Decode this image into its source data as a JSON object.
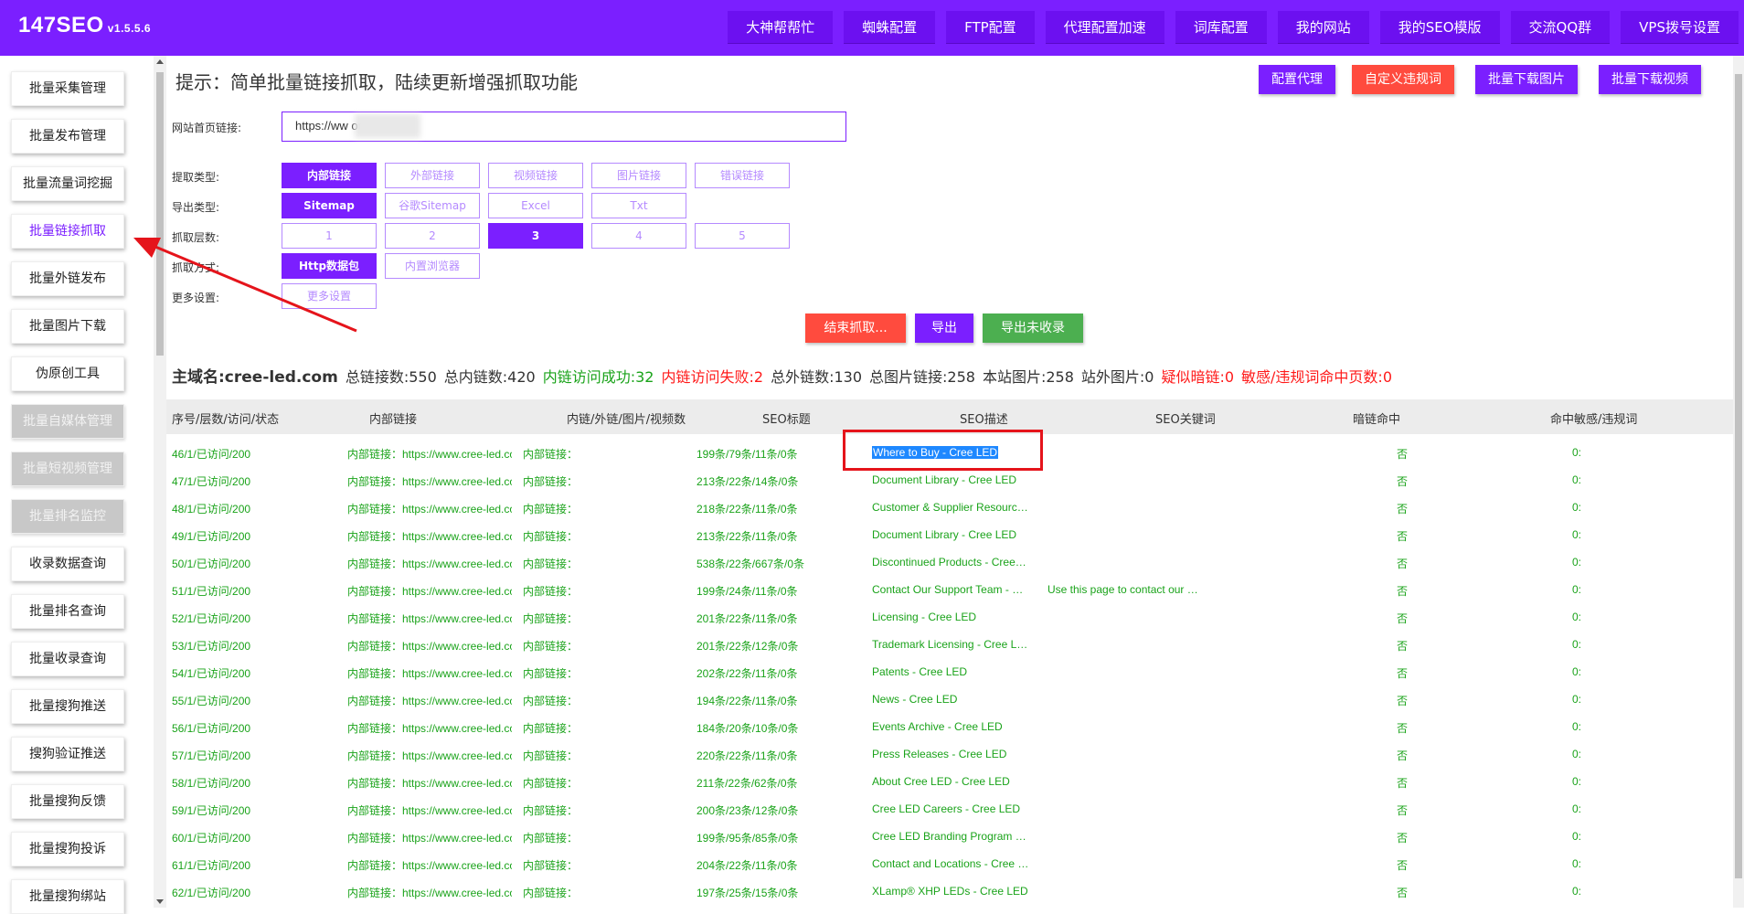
{
  "header": {
    "brand": "147SEO",
    "version": "v1.5.5.6",
    "nav": [
      "大神帮帮忙",
      "蜘蛛配置",
      "FTP配置",
      "代理配置加速",
      "词库配置",
      "我的网站",
      "我的SEO模版",
      "交流QQ群",
      "VPS拨号设置"
    ]
  },
  "sidebar": {
    "items": [
      {
        "label": "批量采集管理",
        "state": "normal"
      },
      {
        "label": "批量发布管理",
        "state": "normal"
      },
      {
        "label": "批量流量词挖掘",
        "state": "normal"
      },
      {
        "label": "批量链接抓取",
        "state": "active"
      },
      {
        "label": "批量外链发布",
        "state": "normal"
      },
      {
        "label": "批量图片下载",
        "state": "normal"
      },
      {
        "label": "伪原创工具",
        "state": "normal"
      },
      {
        "label": "批量自媒体管理",
        "state": "disabled"
      },
      {
        "label": "批量短视频管理",
        "state": "disabled"
      },
      {
        "label": "批量排名监控",
        "state": "disabled"
      },
      {
        "label": "收录数据查询",
        "state": "normal"
      },
      {
        "label": "批量排名查询",
        "state": "normal"
      },
      {
        "label": "批量收录查询",
        "state": "normal"
      },
      {
        "label": "批量搜狗推送",
        "state": "normal"
      },
      {
        "label": "搜狗验证推送",
        "state": "normal"
      },
      {
        "label": "批量搜狗反馈",
        "state": "normal"
      },
      {
        "label": "批量搜狗投诉",
        "state": "normal"
      },
      {
        "label": "批量搜狗绑站",
        "state": "normal"
      }
    ]
  },
  "main": {
    "hint": "提示：简单批量链接抓取，陆续更新增强抓取功能",
    "actions": [
      "配置代理",
      "自定义违规词",
      "批量下载图片",
      "批量下载视频"
    ],
    "url_label": "网站首页链接:",
    "url_value": "https://ww                    om/",
    "fields": {
      "extract_type": {
        "label": "提取类型:",
        "options": [
          "内部链接",
          "外部链接",
          "视频链接",
          "图片链接",
          "错误链接"
        ],
        "selected": "内部链接"
      },
      "export_type": {
        "label": "导出类型:",
        "options": [
          "Sitemap",
          "谷歌Sitemap",
          "Excel",
          "Txt"
        ],
        "selected": "Sitemap"
      },
      "depth": {
        "label": "抓取层数:",
        "options": [
          "1",
          "2",
          "3",
          "4",
          "5"
        ],
        "selected": "3"
      },
      "mode": {
        "label": "抓取方式:",
        "options": [
          "Http数据包",
          "内置浏览器"
        ],
        "selected": "Http数据包"
      },
      "more": {
        "label": "更多设置:",
        "options": [
          "更多设置"
        ]
      }
    },
    "controls": {
      "stop": "结束抓取...",
      "export": "导出",
      "export_unindexed": "导出未收录"
    },
    "stats": {
      "domain": "主域名:cree-led.com",
      "total_links": "总链接数:550",
      "internal_links": "总内链数:420",
      "internal_ok": "内链访问成功:32",
      "internal_fail": "内链访问失败:2",
      "external_links": "总外链数:130",
      "image_links": "总图片链接:258",
      "site_images": "本站图片:258",
      "external_images": "站外图片:0",
      "suspect_hidden": "疑似暗链:0",
      "sensitive_pages": "敏感/违规词命中页数:0"
    },
    "table": {
      "columns": [
        "序号/层数/访问/状态",
        "内部链接",
        "内链/外链/图片/视频数",
        "SEO标题",
        "SEO描述",
        "SEO关键词",
        "暗链命中",
        "命中敏感/违规词"
      ],
      "rows": [
        {
          "seq": "46/1/已访问/200",
          "link": "内部链接：https://www.cree-led.com/",
          "type": "内部链接：",
          "counts": "199条/79条/11条/0条",
          "title": "Where to Buy - Cree LED",
          "desc": "",
          "hidden": "否",
          "hit": "0:"
        },
        {
          "seq": "47/1/已访问/200",
          "link": "内部链接：https://www.cree-led.com/",
          "type": "内部链接：",
          "counts": "213条/22条/14条/0条",
          "title": "Document Library - Cree LED",
          "desc": "",
          "hidden": "否",
          "hit": "0:"
        },
        {
          "seq": "48/1/已访问/200",
          "link": "内部链接：https://www.cree-led.com/",
          "type": "内部链接：",
          "counts": "218条/22条/11条/0条",
          "title": "Customer & Supplier Resources - Cree LED",
          "desc": "",
          "hidden": "否",
          "hit": "0:"
        },
        {
          "seq": "49/1/已访问/200",
          "link": "内部链接：https://www.cree-led.com/",
          "type": "内部链接：",
          "counts": "213条/22条/11条/0条",
          "title": "Document Library - Cree LED",
          "desc": "",
          "hidden": "否",
          "hit": "0:"
        },
        {
          "seq": "50/1/已访问/200",
          "link": "内部链接：https://www.cree-led.com/",
          "type": "内部链接：",
          "counts": "538条/22条/667条/0条",
          "title": "Discontinued Products - Cree LED",
          "desc": "",
          "hidden": "否",
          "hit": "0:"
        },
        {
          "seq": "51/1/已访问/200",
          "link": "内部链接：https://www.cree-led.com/",
          "type": "内部链接：",
          "counts": "199条/24条/11条/0条",
          "title": "Contact Our Support Team - Cree LED",
          "desc": "Use this page to contact our support team",
          "hidden": "否",
          "hit": "0:"
        },
        {
          "seq": "52/1/已访问/200",
          "link": "内部链接：https://www.cree-led.com/",
          "type": "内部链接：",
          "counts": "201条/22条/11条/0条",
          "title": "Licensing - Cree LED",
          "desc": "",
          "hidden": "否",
          "hit": "0:"
        },
        {
          "seq": "53/1/已访问/200",
          "link": "内部链接：https://www.cree-led.com/",
          "type": "内部链接：",
          "counts": "201条/22条/12条/0条",
          "title": "Trademark Licensing - Cree LED",
          "desc": "",
          "hidden": "否",
          "hit": "0:"
        },
        {
          "seq": "54/1/已访问/200",
          "link": "内部链接：https://www.cree-led.com/",
          "type": "内部链接：",
          "counts": "202条/22条/11条/0条",
          "title": "Patents - Cree LED",
          "desc": "",
          "hidden": "否",
          "hit": "0:"
        },
        {
          "seq": "55/1/已访问/200",
          "link": "内部链接：https://www.cree-led.com/",
          "type": "内部链接：",
          "counts": "194条/22条/11条/0条",
          "title": "News - Cree LED",
          "desc": "",
          "hidden": "否",
          "hit": "0:"
        },
        {
          "seq": "56/1/已访问/200",
          "link": "内部链接：https://www.cree-led.com/",
          "type": "内部链接：",
          "counts": "184条/20条/10条/0条",
          "title": "Events Archive - Cree LED",
          "desc": "",
          "hidden": "否",
          "hit": "0:"
        },
        {
          "seq": "57/1/已访问/200",
          "link": "内部链接：https://www.cree-led.com/",
          "type": "内部链接：",
          "counts": "220条/22条/11条/0条",
          "title": "Press Releases - Cree LED",
          "desc": "",
          "hidden": "否",
          "hit": "0:"
        },
        {
          "seq": "58/1/已访问/200",
          "link": "内部链接：https://www.cree-led.com/",
          "type": "内部链接：",
          "counts": "211条/22条/62条/0条",
          "title": "About Cree LED - Cree LED",
          "desc": "",
          "hidden": "否",
          "hit": "0:"
        },
        {
          "seq": "59/1/已访问/200",
          "link": "内部链接：https://www.cree-led.com/",
          "type": "内部链接：",
          "counts": "200条/23条/12条/0条",
          "title": "Cree LED Careers - Cree LED",
          "desc": "",
          "hidden": "否",
          "hit": "0:"
        },
        {
          "seq": "60/1/已访问/200",
          "link": "内部链接：https://www.cree-led.com/",
          "type": "内部链接：",
          "counts": "199条/95条/85条/0条",
          "title": "Cree LED Branding Program - Cree LED",
          "desc": "",
          "hidden": "否",
          "hit": "0:"
        },
        {
          "seq": "61/1/已访问/200",
          "link": "内部链接：https://www.cree-led.com/",
          "type": "内部链接：",
          "counts": "204条/22条/11条/0条",
          "title": "Contact and Locations - Cree LED",
          "desc": "",
          "hidden": "否",
          "hit": "0:"
        },
        {
          "seq": "62/1/已访问/200",
          "link": "内部链接：https://www.cree-led.com/",
          "type": "内部链接：",
          "counts": "197条/25条/15条/0条",
          "title": "XLamp® XHP LEDs - Cree LED",
          "desc": "",
          "hidden": "否",
          "hit": "0:"
        }
      ]
    }
  },
  "colors": {
    "brand": "#7b1fff",
    "danger": "#ff4b3e",
    "success": "#4caf50",
    "ok_text": "#1aa31a",
    "fail_text": "#ff1a1a",
    "annotation": "#e5141b"
  }
}
